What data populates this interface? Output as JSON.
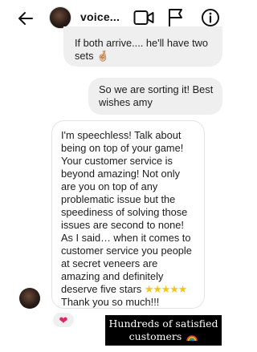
{
  "header": {
    "chat_name": "voice...",
    "icons": [
      "back-arrow-icon",
      "video-call-icon",
      "flag-icon",
      "info-icon"
    ]
  },
  "messages": [
    {
      "sender": "me",
      "text": "If both arrive.... he'll have two sets 🤞🏼"
    },
    {
      "sender": "me",
      "text": "So we are sorting it! Best wishes amy"
    },
    {
      "sender": "them",
      "text": "I'm speechless! Talk about being on top of your game! Your customer service is beyond amazing! Not only are you on top of any problematic issue but the speediness of solving those issues are second to none! As I said… when it comes to customer service you people at secret veneers are amazing and definitely deserve five stars",
      "stars": "★★★★★",
      "text_after": " Thank you so much!!!"
    }
  ],
  "reaction": "❤",
  "caption": {
    "line1": "Hundreds of satisfied",
    "line2": "customers"
  },
  "colors": {
    "bubble": "#efefef",
    "reaction_heart": "#e0245e",
    "caption_bg": "#000000",
    "stars": "#f5c518"
  }
}
